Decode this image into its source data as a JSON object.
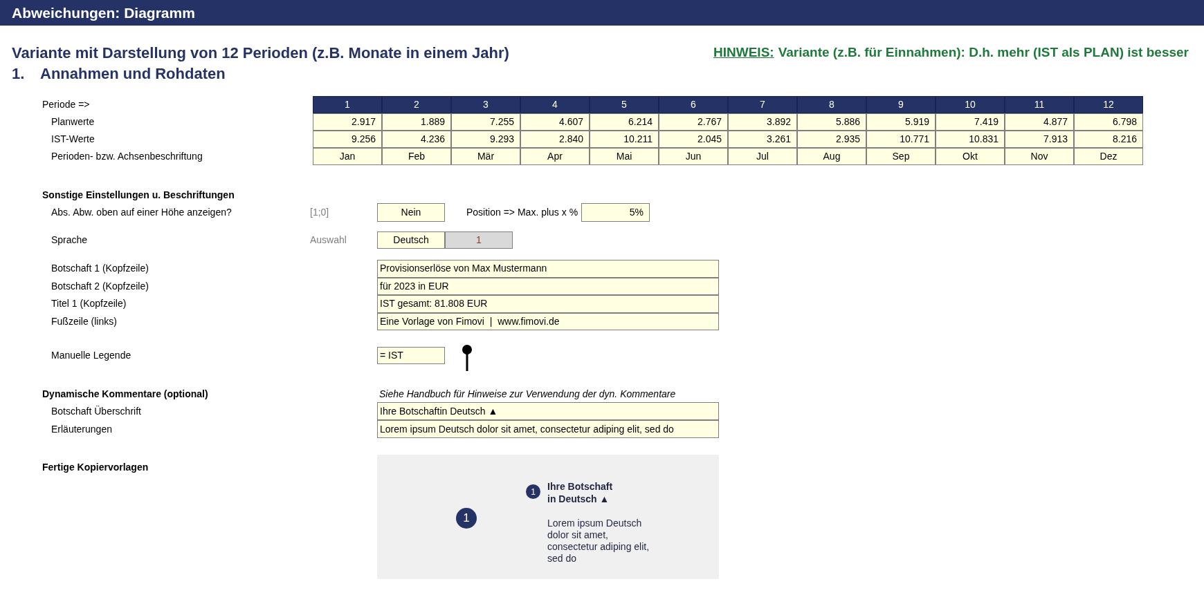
{
  "header": {
    "title": "Abweichungen: Diagramm"
  },
  "subtitle": "Variante mit Darstellung von 12 Perioden (z.B. Monate in einem Jahr)",
  "note": {
    "label": "HINWEIS:",
    "text": "Variante (z.B. für Einnahmen): D.h. mehr (IST als PLAN) ist besser"
  },
  "section": {
    "number": "1.",
    "title": "Annahmen und Rohdaten"
  },
  "table": {
    "header_label": "Periode =>",
    "periods": [
      "1",
      "2",
      "3",
      "4",
      "5",
      "6",
      "7",
      "8",
      "9",
      "10",
      "11",
      "12"
    ],
    "rows": [
      {
        "label": "Planwerte",
        "kind": "number",
        "values": [
          "2.917",
          "1.889",
          "7.255",
          "4.607",
          "6.214",
          "2.767",
          "3.892",
          "5.886",
          "5.919",
          "7.419",
          "4.877",
          "6.798"
        ]
      },
      {
        "label": "IST-Werte",
        "kind": "number",
        "values": [
          "9.256",
          "4.236",
          "9.293",
          "2.840",
          "10.211",
          "2.045",
          "3.261",
          "2.935",
          "10.771",
          "10.831",
          "7.913",
          "8.216"
        ]
      },
      {
        "label": "Perioden- bzw. Achsenbeschriftung",
        "kind": "text",
        "values": [
          "Jan",
          "Feb",
          "Mär",
          "Apr",
          "Mai",
          "Jun",
          "Jul",
          "Aug",
          "Sep",
          "Okt",
          "Nov",
          "Dez"
        ]
      }
    ]
  },
  "settings": {
    "title": "Sonstige Einstellungen u. Beschriftungen",
    "show_abs": {
      "label": "Abs. Abw. oben auf einer Höhe anzeigen?",
      "hint": "[1;0]",
      "value": "Nein",
      "position_label": "Position => Max. plus x %",
      "position_value": "5%"
    },
    "language": {
      "label": "Sprache",
      "hint": "Auswahl",
      "value": "Deutsch",
      "index": "1"
    },
    "texts": [
      {
        "label": "Botschaft 1 (Kopfzeile)",
        "value": "Provisionserlöse von Max Mustermann"
      },
      {
        "label": "Botschaft 2 (Kopfzeile)",
        "value": "für 2023 in EUR"
      },
      {
        "label": "Titel 1 (Kopfzeile)",
        "value": "IST gesamt: 81.808 EUR"
      },
      {
        "label": "Fußzeile (links)",
        "value": "Eine Vorlage von Fimovi  |  www.fimovi.de"
      }
    ],
    "legend": {
      "label": "Manuelle Legende",
      "value": "= IST"
    }
  },
  "comments": {
    "title": "Dynamische Kommentare (optional)",
    "note": "Siehe Handbuch für Hinweise zur Verwendung der dyn. Kommentare",
    "rows": [
      {
        "label": "Botschaft Überschrift",
        "value": "Ihre Botschaftin Deutsch ▲"
      },
      {
        "label": "Erläuterungen",
        "value": "Lorem ipsum Deutsch dolor sit amet, consectetur adiping elit, sed do"
      }
    ]
  },
  "templates": {
    "title": "Fertige Kopiervorlagen",
    "marker": "1",
    "callout": {
      "marker": "1",
      "heading_lines": [
        "Ihre Botschaft",
        "in Deutsch ▲"
      ],
      "body_lines": [
        "Lorem ipsum Deutsch",
        "dolor sit amet,",
        "consectetur adiping elit,",
        "sed do"
      ]
    }
  }
}
